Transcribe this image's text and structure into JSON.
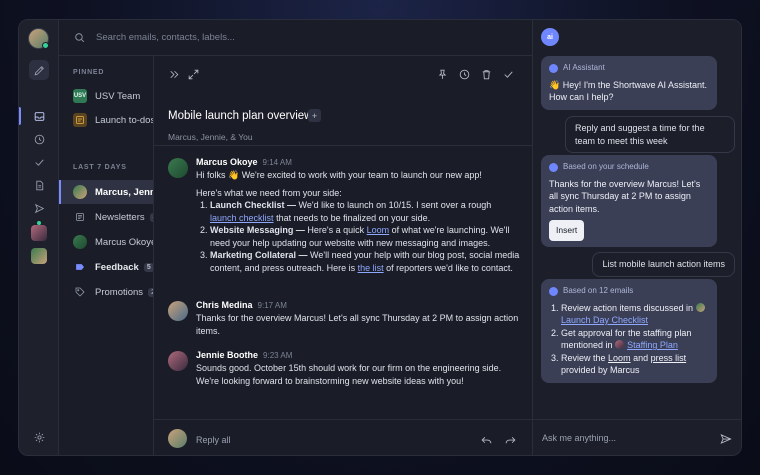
{
  "search": {
    "placeholder": "Search emails, contacts, labels..."
  },
  "list": {
    "pinned_label": "PINNED",
    "pinned": [
      {
        "label": "USV Team",
        "badge": "USV"
      },
      {
        "label": "Launch to-dos"
      }
    ],
    "recent_label": "LAST 7 DAYS",
    "recent": [
      {
        "label": "Marcus, Jennie"
      },
      {
        "label": "Newsletters",
        "count": "4"
      },
      {
        "label": "Marcus Okoye"
      },
      {
        "label": "Feedback",
        "count": "5"
      },
      {
        "label": "Promotions",
        "count": "2"
      }
    ]
  },
  "thread": {
    "title": "Mobile launch plan overview",
    "plus": "+",
    "participants": "Marcus, Jennie, & You",
    "messages": [
      {
        "name": "Marcus Okoye",
        "time": "9:14 AM",
        "greeting": "Hi folks 👋 We're excited to work with your team to launch our new app!",
        "intro": "Here's what we need from your side:",
        "items": [
          {
            "title": "Launch Checklist —",
            "text_a": "We'd like to launch on 10/15. I sent over a rough",
            "link": "launch checklist",
            "text_b": "that needs to be finalized on your side."
          },
          {
            "title": "Website Messaging —",
            "text_a": "Here's a quick",
            "link": "Loom",
            "text_b": "of what we're launching. We'll need your help updating our website with new messaging and images."
          },
          {
            "title": "Marketing Collateral —",
            "text_a": "We'll need your help with our blog post, social media content, and press outreach. Here is",
            "link": "the list",
            "text_b": "of reporters we'd like to contact."
          }
        ]
      },
      {
        "name": "Chris Medina",
        "time": "9:17 AM",
        "text": "Thanks for the overview Marcus! Let's all sync Thursday at 2 PM to assign action items."
      },
      {
        "name": "Jennie Boothe",
        "time": "9:23 AM",
        "text": "Sounds good. October 15th should work for our firm on the engineering side. We're looking forward to brainstorming new website ideas with you!"
      }
    ],
    "reply_label": "Reply all"
  },
  "ai": {
    "logo": "ai",
    "greeting_tag": "AI Assistant",
    "greeting": "👋 Hey! I'm the Shortwave AI Assistant. How can I help?",
    "user1": "Reply and suggest a time for the team to meet this week",
    "schedule_tag": "Based on your schedule",
    "schedule_text": "Thanks for the overview Marcus! Let's all sync Thursday at 2 PM to assign action items.",
    "insert_label": "Insert",
    "user2": "List mobile launch action items",
    "emails_tag": "Based on 12 emails",
    "emails_items": {
      "i1_text": "Review action items discussed in",
      "i1_link": "Launch Day Checklist",
      "i2_text": "Get approval for the staffing plan mentioned in",
      "i2_link": "Staffing Plan",
      "i3_a": "Review the",
      "i3_link1": "Loom",
      "i3_and": "and",
      "i3_link2": "press list",
      "i3_b": "provided by Marcus"
    },
    "input_placeholder": "Ask me anything..."
  },
  "colors": {
    "accent": "#7a8cff",
    "ai_bubble": "#3a3f56",
    "online": "#34d399"
  }
}
